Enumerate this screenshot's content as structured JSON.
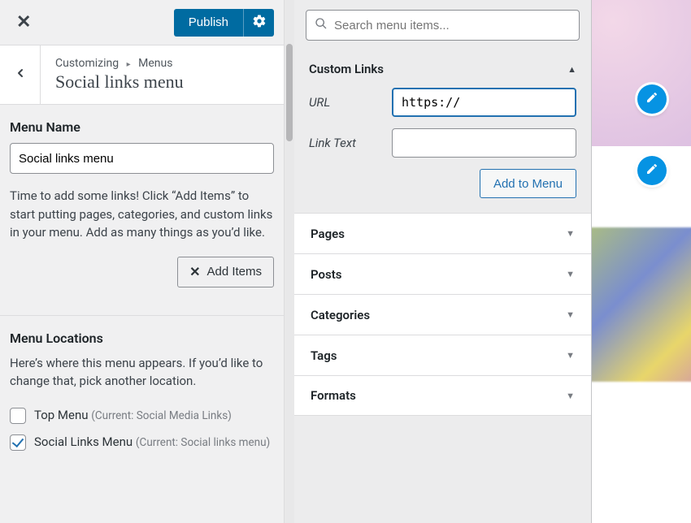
{
  "topbar": {
    "publish_label": "Publish"
  },
  "breadcrumbs": {
    "root": "Customizing",
    "leaf": "Menus"
  },
  "section_title": "Social links menu",
  "menu_name": {
    "label": "Menu Name",
    "value": "Social links menu"
  },
  "help_text": "Time to add some links! Click “Add Items” to start putting pages, categories, and custom links in your menu. Add as many things as you’d like.",
  "add_items_label": "Add Items",
  "locations": {
    "heading": "Menu Locations",
    "help": "Here’s where this menu appears. If you’d like to change that, pick another location.",
    "items": [
      {
        "label": "Top Menu",
        "current": "(Current: Social Media Links)",
        "checked": false
      },
      {
        "label": "Social Links Menu",
        "current": "(Current: Social links menu)",
        "checked": true
      }
    ]
  },
  "search": {
    "placeholder": "Search menu items..."
  },
  "custom_links": {
    "heading": "Custom Links",
    "url_label": "URL",
    "url_value": "https://",
    "text_label": "Link Text",
    "add_label": "Add to Menu"
  },
  "accordion": [
    {
      "label": "Pages"
    },
    {
      "label": "Posts"
    },
    {
      "label": "Categories"
    },
    {
      "label": "Tags"
    },
    {
      "label": "Formats"
    }
  ]
}
